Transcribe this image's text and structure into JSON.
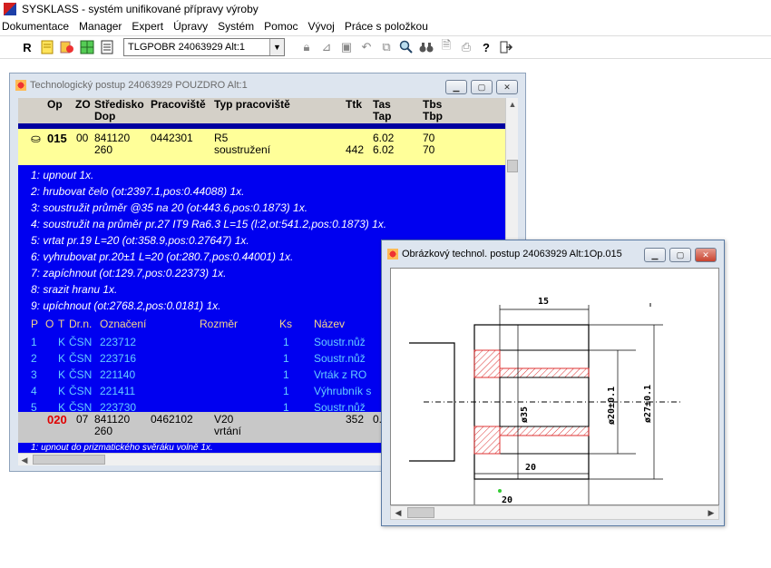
{
  "app": {
    "title": "SYSKLASS - systém unifikované přípravy výroby"
  },
  "menu": [
    "Dokumentace",
    "Manager",
    "Expert",
    "Úpravy",
    "Systém",
    "Pomoc",
    "Vývoj",
    "Práce s položkou"
  ],
  "toolbar": {
    "r_label": "R",
    "combo_value": "TLGPOBR 24063929 Alt:1",
    "icons": [
      "document-icon",
      "stamp-icon",
      "grid-icon",
      "calendar-icon",
      "lock-icon",
      "chart-icon",
      "save-icon",
      "undo-icon",
      "copy-icon",
      "zoom-icon",
      "binoculars-icon",
      "preview-icon",
      "print-icon",
      "help-icon",
      "exit-icon"
    ]
  },
  "window1": {
    "title": "Technologický postup  24063929 POUZDRO Alt:1",
    "columns": {
      "op": "Op",
      "zo": "ZO",
      "stredisko": "Středisko",
      "dop": "Dop",
      "pracoviste": "Pracoviště",
      "typ": "Typ pracoviště",
      "ttk": "Ttk",
      "tas": "Tas",
      "tap": "Tap",
      "tbs": "Tbs",
      "tbp": "Tbp"
    },
    "op1": {
      "op": "015",
      "zo": "00",
      "stredisko": "841120",
      "dop": "260",
      "pracoviste": "0442301",
      "typ_code": "R5",
      "typ_name": "soustružení",
      "ttk": "442",
      "tas": "6.02",
      "tap": "6.02",
      "tbs": "70",
      "tbp": "70"
    },
    "steps": [
      "1: upnout  1x.",
      "2: hrubovat čelo  (ot:2397.1,pos:0.44088) 1x.",
      "3: soustružit  průměr @35 na 20  (ot:443.6,pos:0.1873) 1x.",
      "4: soustružit na průměr  pr.27 IT9 Ra6.3 L=15 (l:2,ot:541.2,pos:0.1873) 1x.",
      "5: vrtat pr.19 L=20 (ot:358.9,pos:0.27647) 1x.",
      "6: vyhrubovat pr.20±1 L=20 (ot:280.7,pos:0.44001) 1x.",
      "7: zapíchnout  (ot:129.7,pos:0.22373) 1x.",
      "8: srazit hranu  1x.",
      "9: upíchnout  (ot:2768.2,pos:0.0181) 1x."
    ],
    "tools_header": {
      "p": "P",
      "o": "O",
      "t": "T",
      "drn": "Dr.n.",
      "oznaceni": "Označení",
      "rozmer": "Rozměr",
      "ks": "Ks",
      "nazev": "Název"
    },
    "tools": [
      {
        "p": "1",
        "t": "K",
        "drn": "ČSN",
        "oznaceni": "223712",
        "ks": "1",
        "nazev": "Soustr.nůž"
      },
      {
        "p": "2",
        "t": "K",
        "drn": "ČSN",
        "oznaceni": "223716",
        "ks": "1",
        "nazev": "Soustr.nůž"
      },
      {
        "p": "3",
        "t": "K",
        "drn": "ČSN",
        "oznaceni": "221140",
        "ks": "1",
        "nazev": "Vrták z RO"
      },
      {
        "p": "4",
        "t": "K",
        "drn": "ČSN",
        "oznaceni": "221411",
        "ks": "1",
        "nazev": "Výhrubník s"
      },
      {
        "p": "5",
        "t": "K",
        "drn": "ČSN",
        "oznaceni": "223730",
        "ks": "1",
        "nazev": "Soustr.nůž"
      }
    ],
    "op2": {
      "op": "020",
      "zo": "07",
      "stredisko": "841120",
      "dop": "260",
      "pracoviste": "0462102",
      "typ_code": "V20",
      "typ_name": "vrtání",
      "ttk": "352",
      "tas": "0."
    },
    "bottom_text": "1: upnout do prizmatického svěráku volně 1x."
  },
  "window2": {
    "title": "Obrázkový technol. postup  24063929 Alt:1Op.015",
    "dims": {
      "d15": "15",
      "d20a": "20",
      "d20b": "20",
      "d35": "ø35",
      "d20tol": "ø20±0.1",
      "d27tol": "ø27±0.1"
    }
  }
}
